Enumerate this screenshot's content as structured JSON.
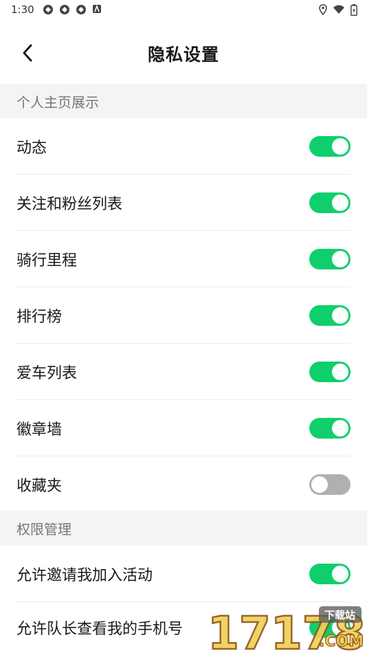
{
  "status_bar": {
    "time": "1:30",
    "left_icons": [
      "notification-icon",
      "notification-icon",
      "notification-icon",
      "app-a-icon"
    ],
    "right_icons": [
      "location-icon",
      "wifi-icon",
      "battery-icon"
    ]
  },
  "header": {
    "title": "隐私设置",
    "back_icon": "chevron-left-icon"
  },
  "sections": [
    {
      "title": "个人主页展示",
      "items": [
        {
          "label": "动态",
          "enabled": true
        },
        {
          "label": "关注和粉丝列表",
          "enabled": true
        },
        {
          "label": "骑行里程",
          "enabled": true
        },
        {
          "label": "排行榜",
          "enabled": true
        },
        {
          "label": "爱车列表",
          "enabled": true
        },
        {
          "label": "徽章墙",
          "enabled": true
        },
        {
          "label": "收藏夹",
          "enabled": false
        }
      ]
    },
    {
      "title": "权限管理",
      "items": [
        {
          "label": "允许邀请我加入活动",
          "enabled": true
        },
        {
          "label": "允许队长查看我的手机号",
          "enabled": true
        }
      ]
    }
  ],
  "watermark": {
    "number": "17178",
    "tag": "下载站",
    "domain": ".COM"
  },
  "colors": {
    "toggle_on": "#0fcf6c",
    "toggle_off": "#b0b0b0",
    "section_bg": "#f4f4f4"
  }
}
